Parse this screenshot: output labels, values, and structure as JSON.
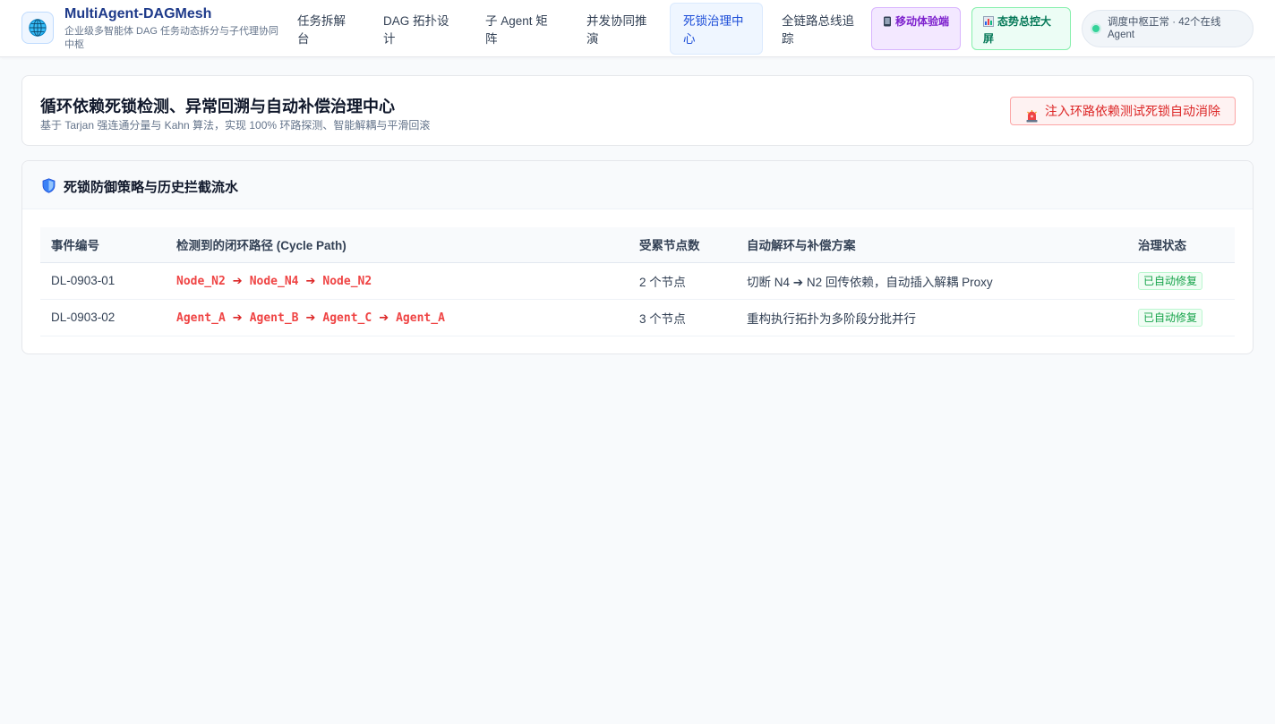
{
  "header": {
    "brand_title": "MultiAgent-DAGMesh",
    "brand_subtitle": "企业级多智能体 DAG 任务动态拆分与子代理协同中枢",
    "nav": [
      {
        "label": "任务拆解台"
      },
      {
        "label": "DAG 拓扑设计"
      },
      {
        "label": "子 Agent 矩阵"
      },
      {
        "label": "并发协同推演"
      },
      {
        "label": "死锁治理中心",
        "active": true
      },
      {
        "label": "全链路总线追踪"
      }
    ],
    "mobile_label": "移动体验端",
    "dashboard_label": "态势总控大屏",
    "status_text": "调度中枢正常 · 42个在线 Agent",
    "status_color": "#34d399"
  },
  "hero": {
    "title": "循环依赖死锁检测、异常回溯与自动补偿治理中心",
    "subtitle": "基于 Tarjan 强连通分量与 Kahn 算法，实现 100% 环路探测、智能解耦与平滑回滚",
    "inject_label": "注入环路依赖测试死锁自动消除"
  },
  "policy": {
    "title": "死锁防御策略与历史拦截流水",
    "columns": [
      "事件编号",
      "检测到的闭环路径 (Cycle Path)",
      "受累节点数",
      "自动解环与补偿方案",
      "治理状态"
    ],
    "rows": [
      {
        "id": "DL-0903-01",
        "path": [
          "Node_N2",
          "Node_N4",
          "Node_N2"
        ],
        "nodes": "2 个节点",
        "plan": "切断 N4 ➔ N2 回传依赖，自动插入解耦 Proxy",
        "status": "已自动修复"
      },
      {
        "id": "DL-0903-02",
        "path": [
          "Agent_A",
          "Agent_B",
          "Agent_C",
          "Agent_A"
        ],
        "nodes": "3 个节点",
        "plan": "重构执行拓扑为多阶段分批并行",
        "status": "已自动修复"
      }
    ]
  },
  "colors": {
    "accent": "#1d4ed8",
    "danger": "#dc2626",
    "success": "#16a34a",
    "background": "#f8fafc"
  },
  "icons": {
    "logo": "globe-icon",
    "mobile": "phone-icon",
    "dashboard": "bar-chart-icon",
    "inject": "alarm-siren-icon",
    "policy": "shield-icon",
    "path_arrow": "arrow-right-icon"
  }
}
